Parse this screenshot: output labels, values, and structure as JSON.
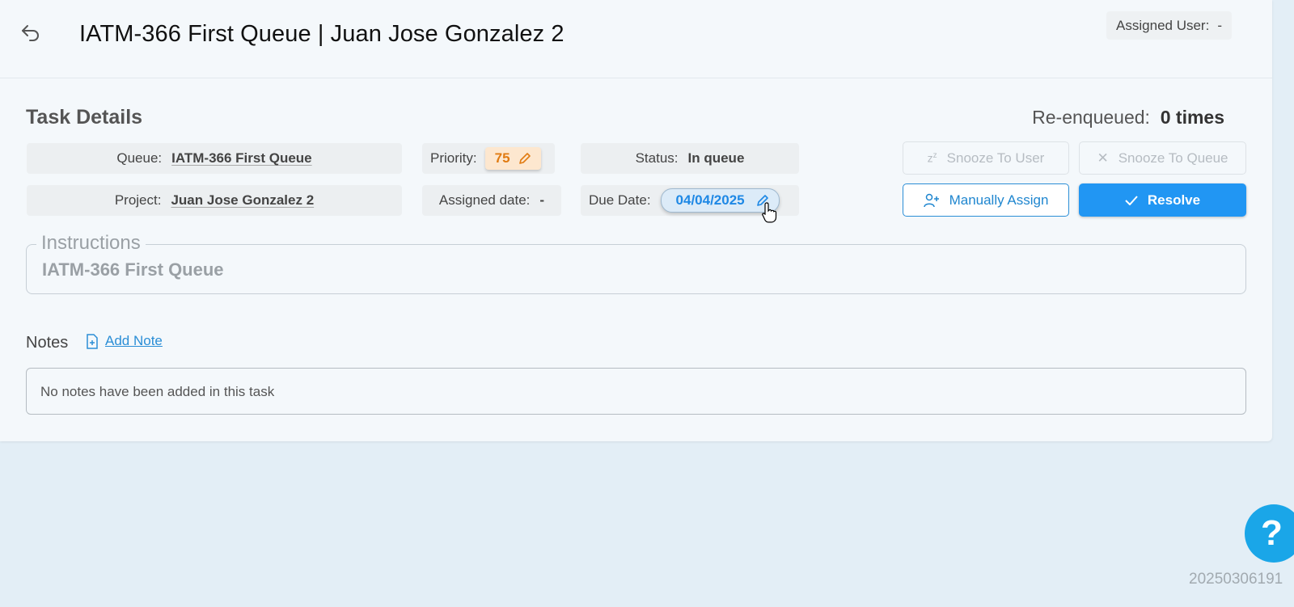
{
  "header": {
    "title": "IATM-366 First Queue | Juan Jose Gonzalez 2",
    "assigned_user_label": "Assigned User:",
    "assigned_user_value": "-"
  },
  "task": {
    "section_title": "Task Details",
    "reenqueued_label": "Re-enqueued:",
    "reenqueued_value": "0 times",
    "queue_label": "Queue:",
    "queue_value": "IATM-366 First Queue",
    "project_label": "Project:",
    "project_value": "Juan Jose Gonzalez 2",
    "priority_label": "Priority:",
    "priority_value": "75",
    "assigned_date_label": "Assigned date:",
    "assigned_date_value": "-",
    "status_label": "Status:",
    "status_value": "In queue",
    "due_date_label": "Due Date:",
    "due_date_value": "04/04/2025"
  },
  "actions": {
    "snooze_user": "Snooze To User",
    "snooze_queue": "Snooze To Queue",
    "manually_assign": "Manually Assign",
    "resolve": "Resolve"
  },
  "instructions": {
    "label": "Instructions",
    "text": "IATM-366 First Queue"
  },
  "notes": {
    "label": "Notes",
    "add_label": "Add Note",
    "empty_text": "No notes have been added in this task"
  },
  "footer": {
    "help_glyph": "?",
    "build_id": "20250306191"
  },
  "colors": {
    "primary": "#2196f3",
    "priority_bg": "#fde7cf",
    "priority_text": "#e17b12",
    "help_bg": "#1aa6e8"
  }
}
